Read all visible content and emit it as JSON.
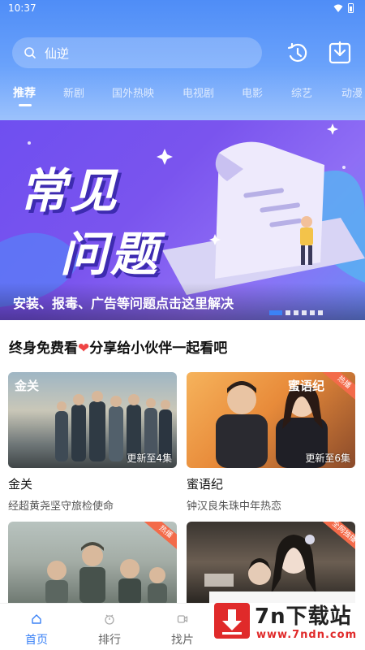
{
  "status_bar": {
    "time": "10:37"
  },
  "search": {
    "query": "仙逆"
  },
  "tabs": [
    {
      "label": "推荐"
    },
    {
      "label": "新剧"
    },
    {
      "label": "国外热映"
    },
    {
      "label": "电视剧"
    },
    {
      "label": "电影"
    },
    {
      "label": "综艺"
    },
    {
      "label": "动漫"
    }
  ],
  "banner": {
    "headline_line1": "常见",
    "headline_line2": "问题",
    "caption": "安装、报毒、广告等问题点击这里解决"
  },
  "section": {
    "title_before": "终身免费看",
    "title_after": "分享给小伙伴一起看吧"
  },
  "cards": [
    {
      "title": "金关",
      "subtitle": "经超黄尧坚守旅检使命",
      "badge": "更新至4集",
      "logo": "金关",
      "hot": ""
    },
    {
      "title": "蜜语纪",
      "subtitle": "钟汉良朱珠中年热恋",
      "badge": "更新至6集",
      "logo": "蜜语纪",
      "hot": "热播"
    },
    {
      "title": "",
      "subtitle": "",
      "badge": "",
      "logo": "",
      "hot": "热播"
    },
    {
      "title": "",
      "subtitle": "",
      "badge": "",
      "logo": "",
      "hot": "全网独播"
    }
  ],
  "bottom_nav": [
    {
      "label": "首页"
    },
    {
      "label": "排行"
    },
    {
      "label": "找片"
    }
  ],
  "watermark": {
    "title": "7n下载站",
    "url": "www.7ndn.com"
  },
  "colors": {
    "accent": "#3b82f6",
    "header_top": "#4f8df7",
    "banner": "#7a54ee",
    "hot": "#f36b4a"
  }
}
